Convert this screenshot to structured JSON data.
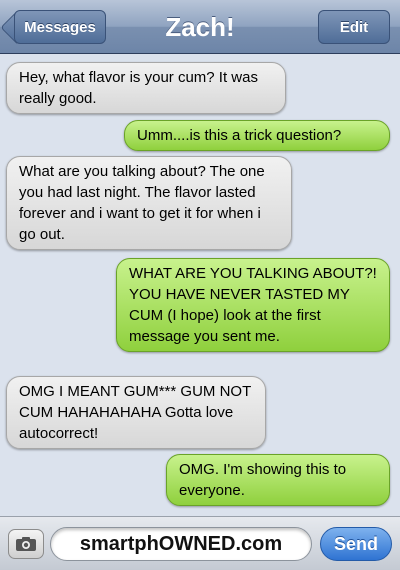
{
  "header": {
    "title": "Zach!",
    "back_label": "Messages",
    "edit_label": "Edit"
  },
  "messages": [
    {
      "direction": "received",
      "text": "Hey, what flavor is your cum? It was really good."
    },
    {
      "direction": "sent",
      "text": "Umm....is this a trick question?"
    },
    {
      "direction": "received",
      "text": "What are you talking about? The one you had last night. The flavor lasted forever and i want to get it for when i go out."
    },
    {
      "direction": "sent",
      "text": "WHAT ARE YOU TALKING ABOUT?! YOU HAVE NEVER TASTED MY CUM (I hope) look at the first message you sent me."
    },
    {
      "direction": "received",
      "text": "OMG I MEANT GUM*** GUM NOT CUM HAHAHAHAHA Gotta love autocorrect!"
    },
    {
      "direction": "sent",
      "text": "OMG. I'm showing this to everyone."
    }
  ],
  "composer": {
    "input_value": "smartphOWNED.com",
    "send_label": "Send",
    "camera_icon": "camera-icon"
  },
  "colors": {
    "sent_bubble": "#9bd84a",
    "received_bubble": "#e2e2e2",
    "send_button": "#2f73d2"
  }
}
